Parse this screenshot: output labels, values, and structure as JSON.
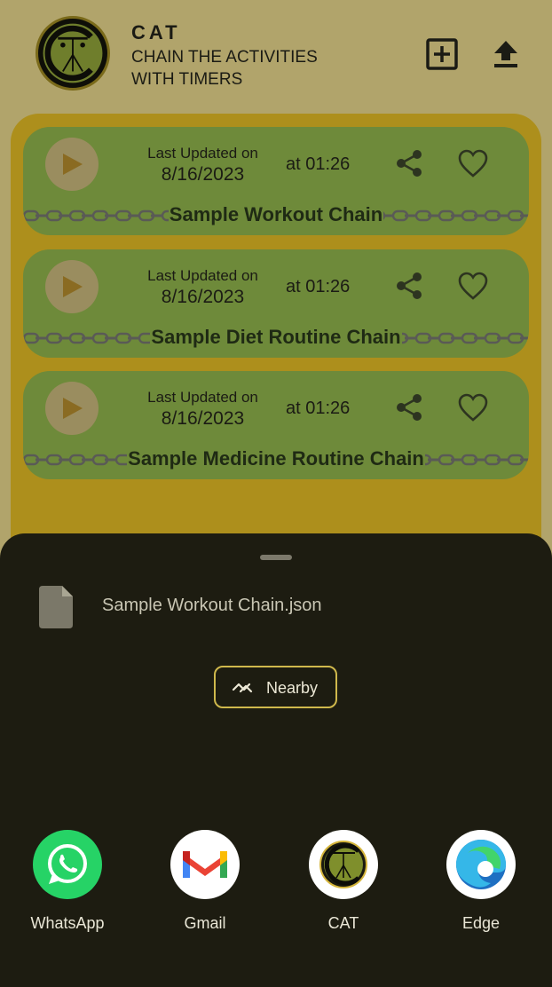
{
  "app": {
    "name": "CAT",
    "subtitle": "CHAIN THE ACTIVITIES WITH TIMERS",
    "icons": {
      "add": "add-box-icon",
      "upload": "upload-icon",
      "logo": "cat-logo"
    }
  },
  "chains": [
    {
      "title": "Sample Workout Chain",
      "updated_label": "Last Updated on",
      "date": "8/16/2023",
      "time": "at 01:26"
    },
    {
      "title": "Sample Diet Routine Chain",
      "updated_label": "Last Updated on",
      "date": "8/16/2023",
      "time": "at 01:26"
    },
    {
      "title": "Sample Medicine Routine Chain",
      "updated_label": "Last Updated on",
      "date": "8/16/2023",
      "time": "at 01:26"
    }
  ],
  "share_sheet": {
    "file_name": "Sample Workout Chain.json",
    "nearby_label": "Nearby",
    "targets": [
      {
        "label": "WhatsApp",
        "icon": "whatsapp-icon"
      },
      {
        "label": "Gmail",
        "icon": "gmail-icon"
      },
      {
        "label": "CAT",
        "icon": "cat-icon"
      },
      {
        "label": "Edge",
        "icon": "edge-icon"
      }
    ]
  },
  "colors": {
    "card": "#6e8a3a",
    "list_background": "#ad8f1c",
    "sheet": "#1d1c11",
    "nearby_border": "#cfb84c"
  }
}
